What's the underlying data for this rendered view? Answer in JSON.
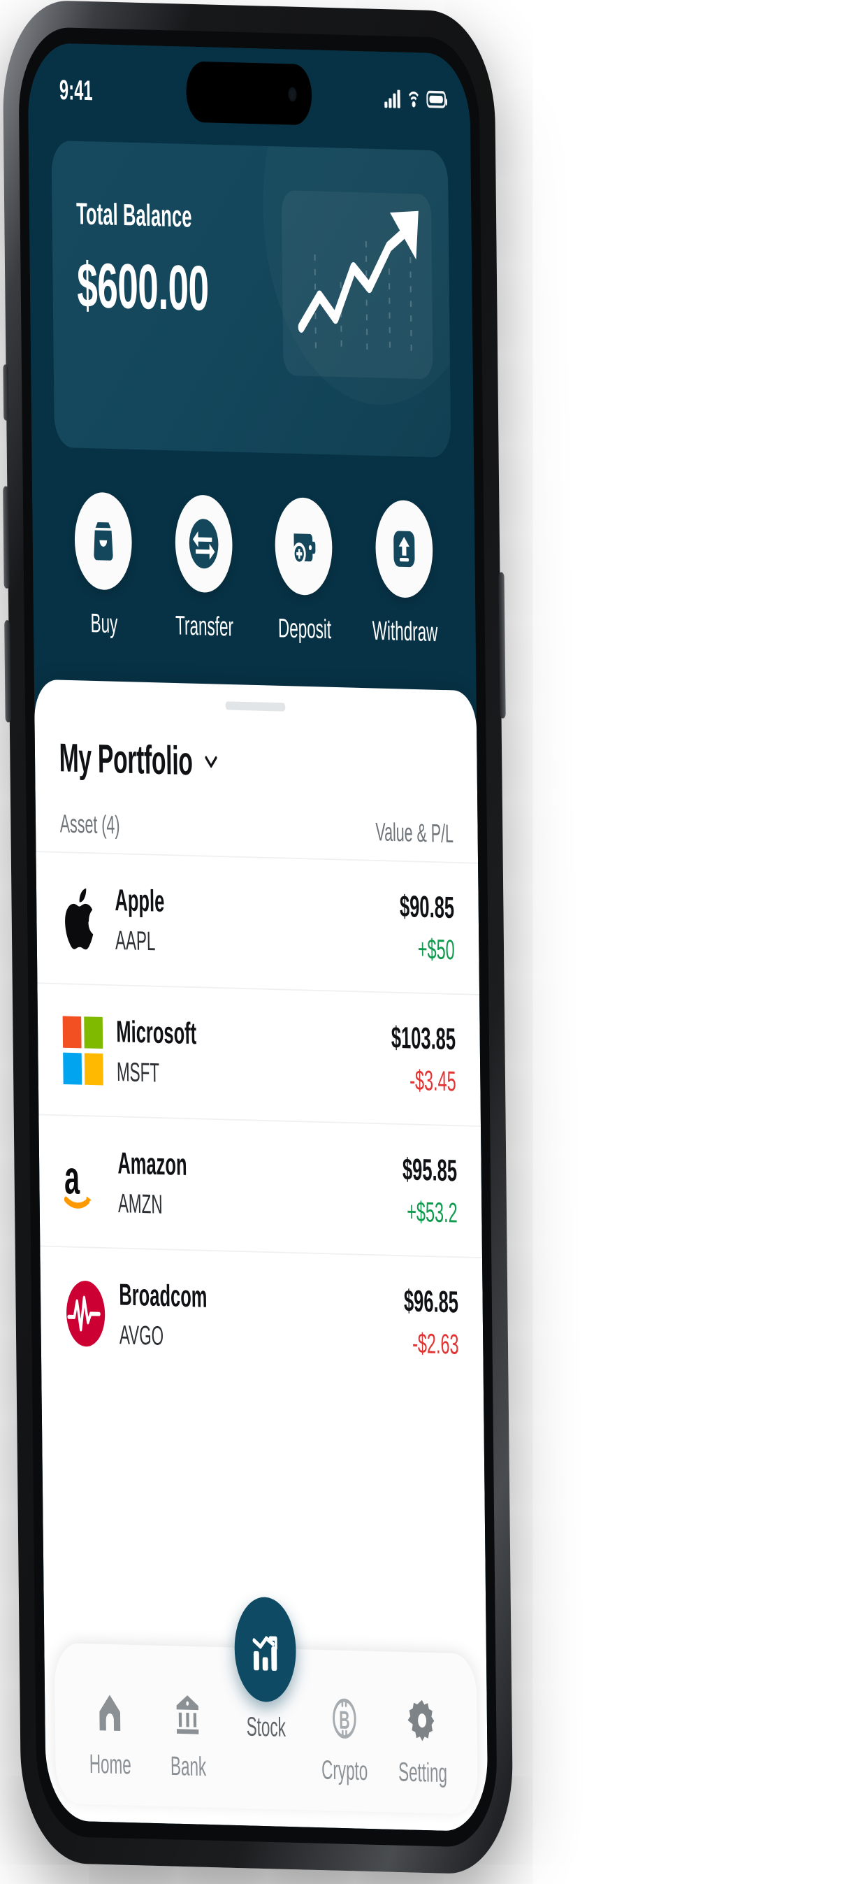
{
  "status_bar": {
    "time": "9:41",
    "icons": [
      "signal-bars-icon",
      "wifi-icon",
      "battery-icon"
    ]
  },
  "balance_card": {
    "label": "Total Balance",
    "amount": "$600.00",
    "chart_icon": "upward-trend-chart-icon"
  },
  "quick_actions": [
    {
      "label": "Buy",
      "icon": "shopping-bag-icon"
    },
    {
      "label": "Transfer",
      "icon": "transfer-arrows-icon"
    },
    {
      "label": "Deposit",
      "icon": "wallet-plus-icon"
    },
    {
      "label": "Withdraw",
      "icon": "upload-box-icon"
    }
  ],
  "portfolio": {
    "title": "My Portfolio",
    "chevron_icon": "chevron-down-icon",
    "columns": {
      "left": "Asset (4)",
      "right": "Value & P/L"
    },
    "assets": [
      {
        "name": "Apple",
        "ticker": "AAPL",
        "value": "$90.85",
        "pl": "+$50",
        "pl_direction": "up",
        "logo": "apple-logo-icon"
      },
      {
        "name": "Microsoft",
        "ticker": "MSFT",
        "value": "$103.85",
        "pl": "-$3.45",
        "pl_direction": "down",
        "logo": "microsoft-logo-icon"
      },
      {
        "name": "Amazon",
        "ticker": "AMZN",
        "value": "$95.85",
        "pl": "+$53.2",
        "pl_direction": "up",
        "logo": "amazon-logo-icon"
      },
      {
        "name": "Broadcom",
        "ticker": "AVGO",
        "value": "$96.85",
        "pl": "-$2.63",
        "pl_direction": "down",
        "logo": "broadcom-logo-icon"
      }
    ]
  },
  "tab_bar": {
    "items": [
      {
        "label": "Home",
        "icon": "home-icon",
        "active": false
      },
      {
        "label": "Bank",
        "icon": "bank-icon",
        "active": false
      },
      {
        "label": "Stock",
        "icon": "bar-chart-icon",
        "active": true
      },
      {
        "label": "Crypto",
        "icon": "bitcoin-icon",
        "active": false
      },
      {
        "label": "Setting",
        "icon": "gear-icon",
        "active": false
      }
    ]
  },
  "colors": {
    "brand_dark": "#073245",
    "card": "#14475c",
    "accent": "#0e4a63",
    "profit": "#0f9b4e",
    "loss": "#e33434",
    "ms_red": "#f25022",
    "ms_green": "#7fba00",
    "ms_blue": "#00a4ef",
    "ms_yellow": "#ffb900",
    "amazon_orange": "#ff9900",
    "broadcom_red": "#cc0033"
  }
}
